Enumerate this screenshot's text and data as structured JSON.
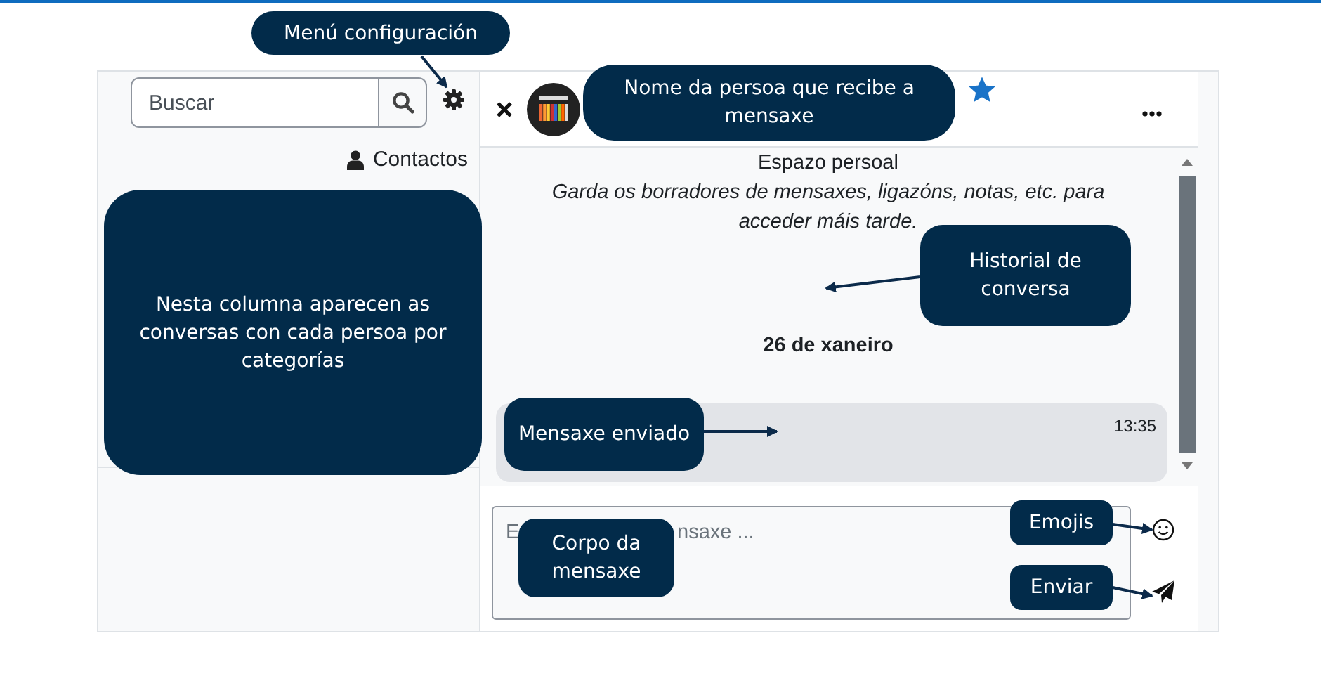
{
  "annotations": [
    {
      "text": "Menú configuración"
    },
    {
      "text": "Nome da persoa que recibe a mensaxe"
    },
    {
      "text": "Nesta columna aparecen as conversas con cada persoa por categorías"
    },
    {
      "text": "Historial de conversa"
    },
    {
      "text": "Mensaxe enviado"
    },
    {
      "text": "Corpo da mensaxe"
    },
    {
      "text": "Emojis"
    },
    {
      "text": "Enviar"
    }
  ],
  "search": {
    "placeholder": "Buscar"
  },
  "contacts_link": "Contactos",
  "chat_header": {
    "starred": true
  },
  "conversation": {
    "title": "Espazo persoal",
    "description": "Garda os borradores de mensaxes, ligazóns, notas, etc. para acceder máis tarde.",
    "date": "26 de xaneiro",
    "messages": [
      {
        "time": "13:35"
      }
    ]
  },
  "composer": {
    "placeholder_parts": [
      "E",
      "nsaxe ..."
    ]
  }
}
